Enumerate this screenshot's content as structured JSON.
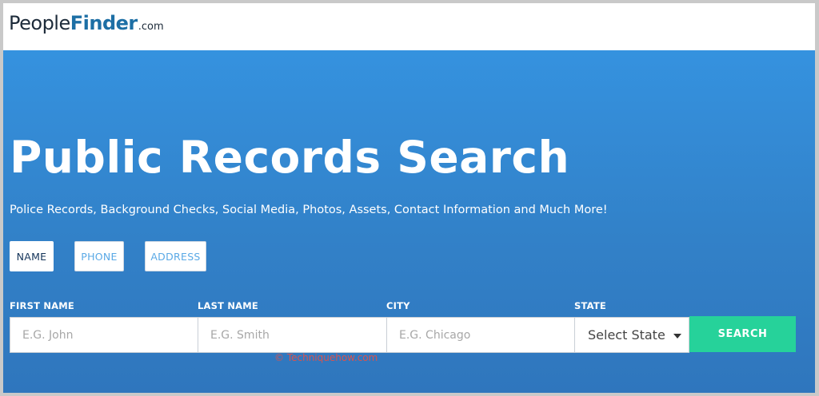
{
  "header": {
    "logo_people": "People",
    "logo_finder": "Finder",
    "logo_com": ".com"
  },
  "hero": {
    "title": "Public Records Search",
    "subtitle": "Police Records, Background Checks, Social Media, Photos, Assets, Contact Information and Much More!"
  },
  "tabs": [
    {
      "label": "NAME",
      "active": true
    },
    {
      "label": "PHONE",
      "active": false
    },
    {
      "label": "ADDRESS",
      "active": false
    }
  ],
  "form": {
    "first_name": {
      "label": "FIRST NAME",
      "placeholder": "E.G. John",
      "value": ""
    },
    "last_name": {
      "label": "LAST NAME",
      "placeholder": "E.G. Smith",
      "value": ""
    },
    "city": {
      "label": "CITY",
      "placeholder": "E.G. Chicago",
      "value": ""
    },
    "state": {
      "label": "STATE",
      "selected": "Select State"
    },
    "search_label": "SEARCH"
  },
  "watermark": "© Techniquehow.com",
  "colors": {
    "brand_dark": "#1d2b3a",
    "brand_blue": "#1d6fa5",
    "hero_blue": "#3592df",
    "search_green": "#26d29a",
    "watermark_red": "#d9534f"
  }
}
